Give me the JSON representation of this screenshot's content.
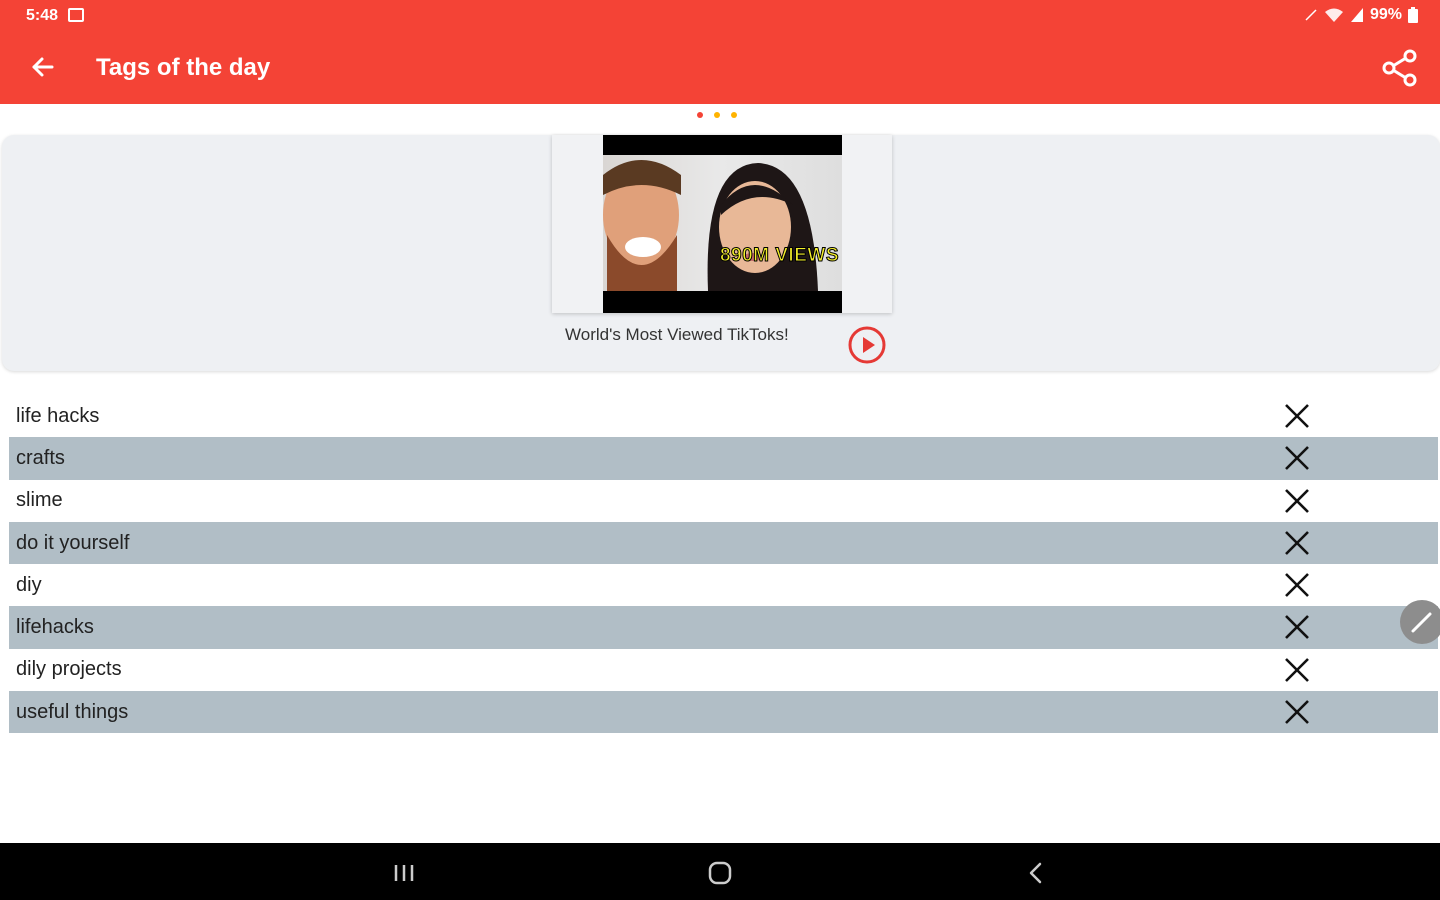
{
  "status_bar": {
    "time": "5:48",
    "battery": "99%",
    "icons": [
      "image-icon",
      "mute-icon",
      "wifi-icon",
      "signal-icon",
      "battery-icon"
    ]
  },
  "app_bar": {
    "title": "Tags of the day",
    "back_icon": "arrow-left-icon",
    "share_icon": "share-icon",
    "background": "#f44336"
  },
  "pager": {
    "dots": [
      {
        "color": "#f44336",
        "active": true
      },
      {
        "color": "#ffb300",
        "active": false
      },
      {
        "color": "#ffb300",
        "active": false
      }
    ]
  },
  "featured_video": {
    "thumbnail_overlay": "890M VIEWS",
    "title": "World's Most Viewed TikToks!",
    "play_icon": "play-circle-icon"
  },
  "tags": [
    {
      "label": "life hacks"
    },
    {
      "label": "crafts"
    },
    {
      "label": "slime"
    },
    {
      "label": "do it yourself"
    },
    {
      "label": "diy"
    },
    {
      "label": "lifehacks"
    },
    {
      "label": "dily projects"
    },
    {
      "label": "useful things"
    }
  ],
  "colors": {
    "accent": "#f44336",
    "row_alt": "#b1bec6",
    "card_bg": "#eef0f3"
  },
  "nav_bar": {
    "buttons": [
      "recents-icon",
      "home-icon",
      "back-icon"
    ]
  }
}
